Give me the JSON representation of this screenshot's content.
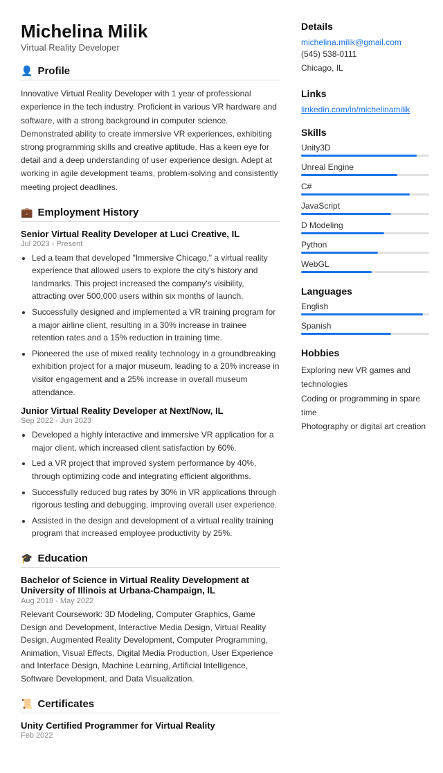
{
  "header": {
    "name": "Michelina Milik",
    "job_title": "Virtual Reality Developer"
  },
  "profile": {
    "section_title": "Profile",
    "icon": "👤",
    "text": "Innovative Virtual Reality Developer with 1 year of professional experience in the tech industry. Proficient in various VR hardware and software, with a strong background in computer science. Demonstrated ability to create immersive VR experiences, exhibiting strong programming skills and creative aptitude. Has a keen eye for detail and a deep understanding of user experience design. Adept at working in agile development teams, problem-solving and consistently meeting project deadlines."
  },
  "employment": {
    "section_title": "Employment History",
    "icon": "💼",
    "jobs": [
      {
        "title": "Senior Virtual Reality Developer at Luci Creative, IL",
        "period": "Jul 2023 - Present",
        "bullets": [
          "Led a team that developed \"Immersive Chicago,\" a virtual reality experience that allowed users to explore the city's history and landmarks. This project increased the company's visibility, attracting over 500,000 users within six months of launch.",
          "Successfully designed and implemented a VR training program for a major airline client, resulting in a 30% increase in trainee retention rates and a 15% reduction in training time.",
          "Pioneered the use of mixed reality technology in a groundbreaking exhibition project for a major museum, leading to a 20% increase in visitor engagement and a 25% increase in overall museum attendance."
        ]
      },
      {
        "title": "Junior Virtual Reality Developer at Next/Now, IL",
        "period": "Sep 2022 - Jun 2023",
        "bullets": [
          "Developed a highly interactive and immersive VR application for a major client, which increased client satisfaction by 60%.",
          "Led a VR project that improved system performance by 40%, through optimizing code and integrating efficient algorithms.",
          "Successfully reduced bug rates by 30% in VR applications through rigorous testing and debugging, improving overall user experience.",
          "Assisted in the design and development of a virtual reality training program that increased employee productivity by 25%."
        ]
      }
    ]
  },
  "education": {
    "section_title": "Education",
    "icon": "🎓",
    "degree": "Bachelor of Science in Virtual Reality Development at University of Illinois at Urbana-Champaign, IL",
    "period": "Aug 2018 - May 2022",
    "text": "Relevant Coursework: 3D Modeling, Computer Graphics, Game Design and Development, Interactive Media Design, Virtual Reality Design, Augmented Reality Development, Computer Programming, Animation, Visual Effects, Digital Media Production, User Experience and Interface Design, Machine Learning, Artificial Intelligence, Software Development, and Data Visualization."
  },
  "certificates": {
    "section_title": "Certificates",
    "icon": "📜",
    "items": [
      {
        "title": "Unity Certified Programmer for Virtual Reality",
        "period": "Feb 2022"
      }
    ]
  },
  "details": {
    "section_title": "Details",
    "email": "michelina.milik@gmail.com",
    "phone": "(545) 538-0111",
    "location": "Chicago, IL"
  },
  "links": {
    "section_title": "Links",
    "linkedin": "linkedin.com/in/michelinamilik"
  },
  "skills": {
    "section_title": "Skills",
    "items": [
      {
        "name": "Unity3D",
        "level": 90
      },
      {
        "name": "Unreal Engine",
        "level": 75
      },
      {
        "name": "C#",
        "level": 85
      },
      {
        "name": "JavaScript",
        "level": 70
      },
      {
        "name": "D Modeling",
        "level": 65
      },
      {
        "name": "Python",
        "level": 60
      },
      {
        "name": "WebGL",
        "level": 55
      }
    ]
  },
  "languages": {
    "section_title": "Languages",
    "items": [
      {
        "name": "English",
        "level": 95
      },
      {
        "name": "Spanish",
        "level": 70
      }
    ]
  },
  "hobbies": {
    "section_title": "Hobbies",
    "items": [
      "Exploring new VR games and technologies",
      "Coding or programming in spare time",
      "Photography or digital art creation"
    ]
  }
}
